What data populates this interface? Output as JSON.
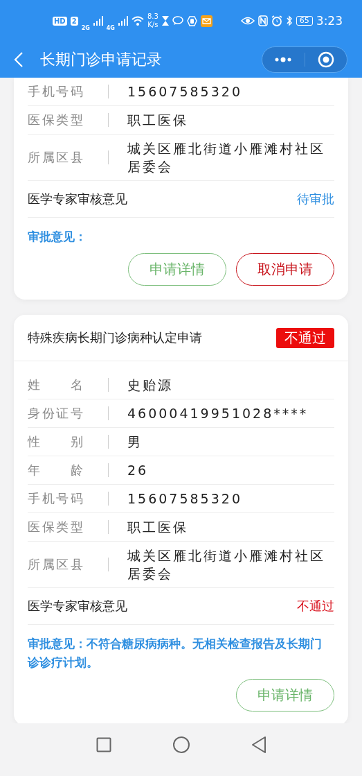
{
  "status_bar": {
    "hd": "HD",
    "sim": "2",
    "net_1": "2G",
    "net_2": "4G",
    "speed_value": "8.3",
    "speed_unit": "K/s",
    "battery": "65",
    "time": "3:23"
  },
  "nav": {
    "title": "长期门诊申请记录"
  },
  "records": [
    {
      "fields": [
        {
          "label": "手机号码",
          "value": "15607585320"
        },
        {
          "label": "医保类型",
          "value": "职工医保"
        },
        {
          "label": "所属区县",
          "value": "城关区雁北街道小雁滩村社区居委会"
        }
      ],
      "expert_review": {
        "label": "医学专家审核意见",
        "value": "待审批",
        "color": "#2f8fe0"
      },
      "approval": "审批意见：",
      "buttons": [
        {
          "label": "申请详情",
          "kind": "detail"
        },
        {
          "label": "取消申请",
          "kind": "cancel"
        }
      ]
    },
    {
      "title": "特殊疾病长期门诊病种认定申请",
      "status": {
        "label": "不通过",
        "color": "#ec0d0d"
      },
      "fields": [
        {
          "label": "姓名",
          "value": "史贻源"
        },
        {
          "label": "身份证号",
          "value": "46000419951028****"
        },
        {
          "label": "性别",
          "value": "男"
        },
        {
          "label": "年龄",
          "value": "26"
        },
        {
          "label": "手机号码",
          "value": "15607585320"
        },
        {
          "label": "医保类型",
          "value": "职工医保"
        },
        {
          "label": "所属区县",
          "value": "城关区雁北街道小雁滩村社区居委会"
        }
      ],
      "expert_review": {
        "label": "医学专家审核意见",
        "value": "不通过",
        "color": "#d9101c"
      },
      "approval": "审批意见：不符合糖尿病病种。无相关检查报告及长期门诊诊疗计划。",
      "buttons": [
        {
          "label": "申请详情",
          "kind": "detail"
        }
      ]
    }
  ]
}
